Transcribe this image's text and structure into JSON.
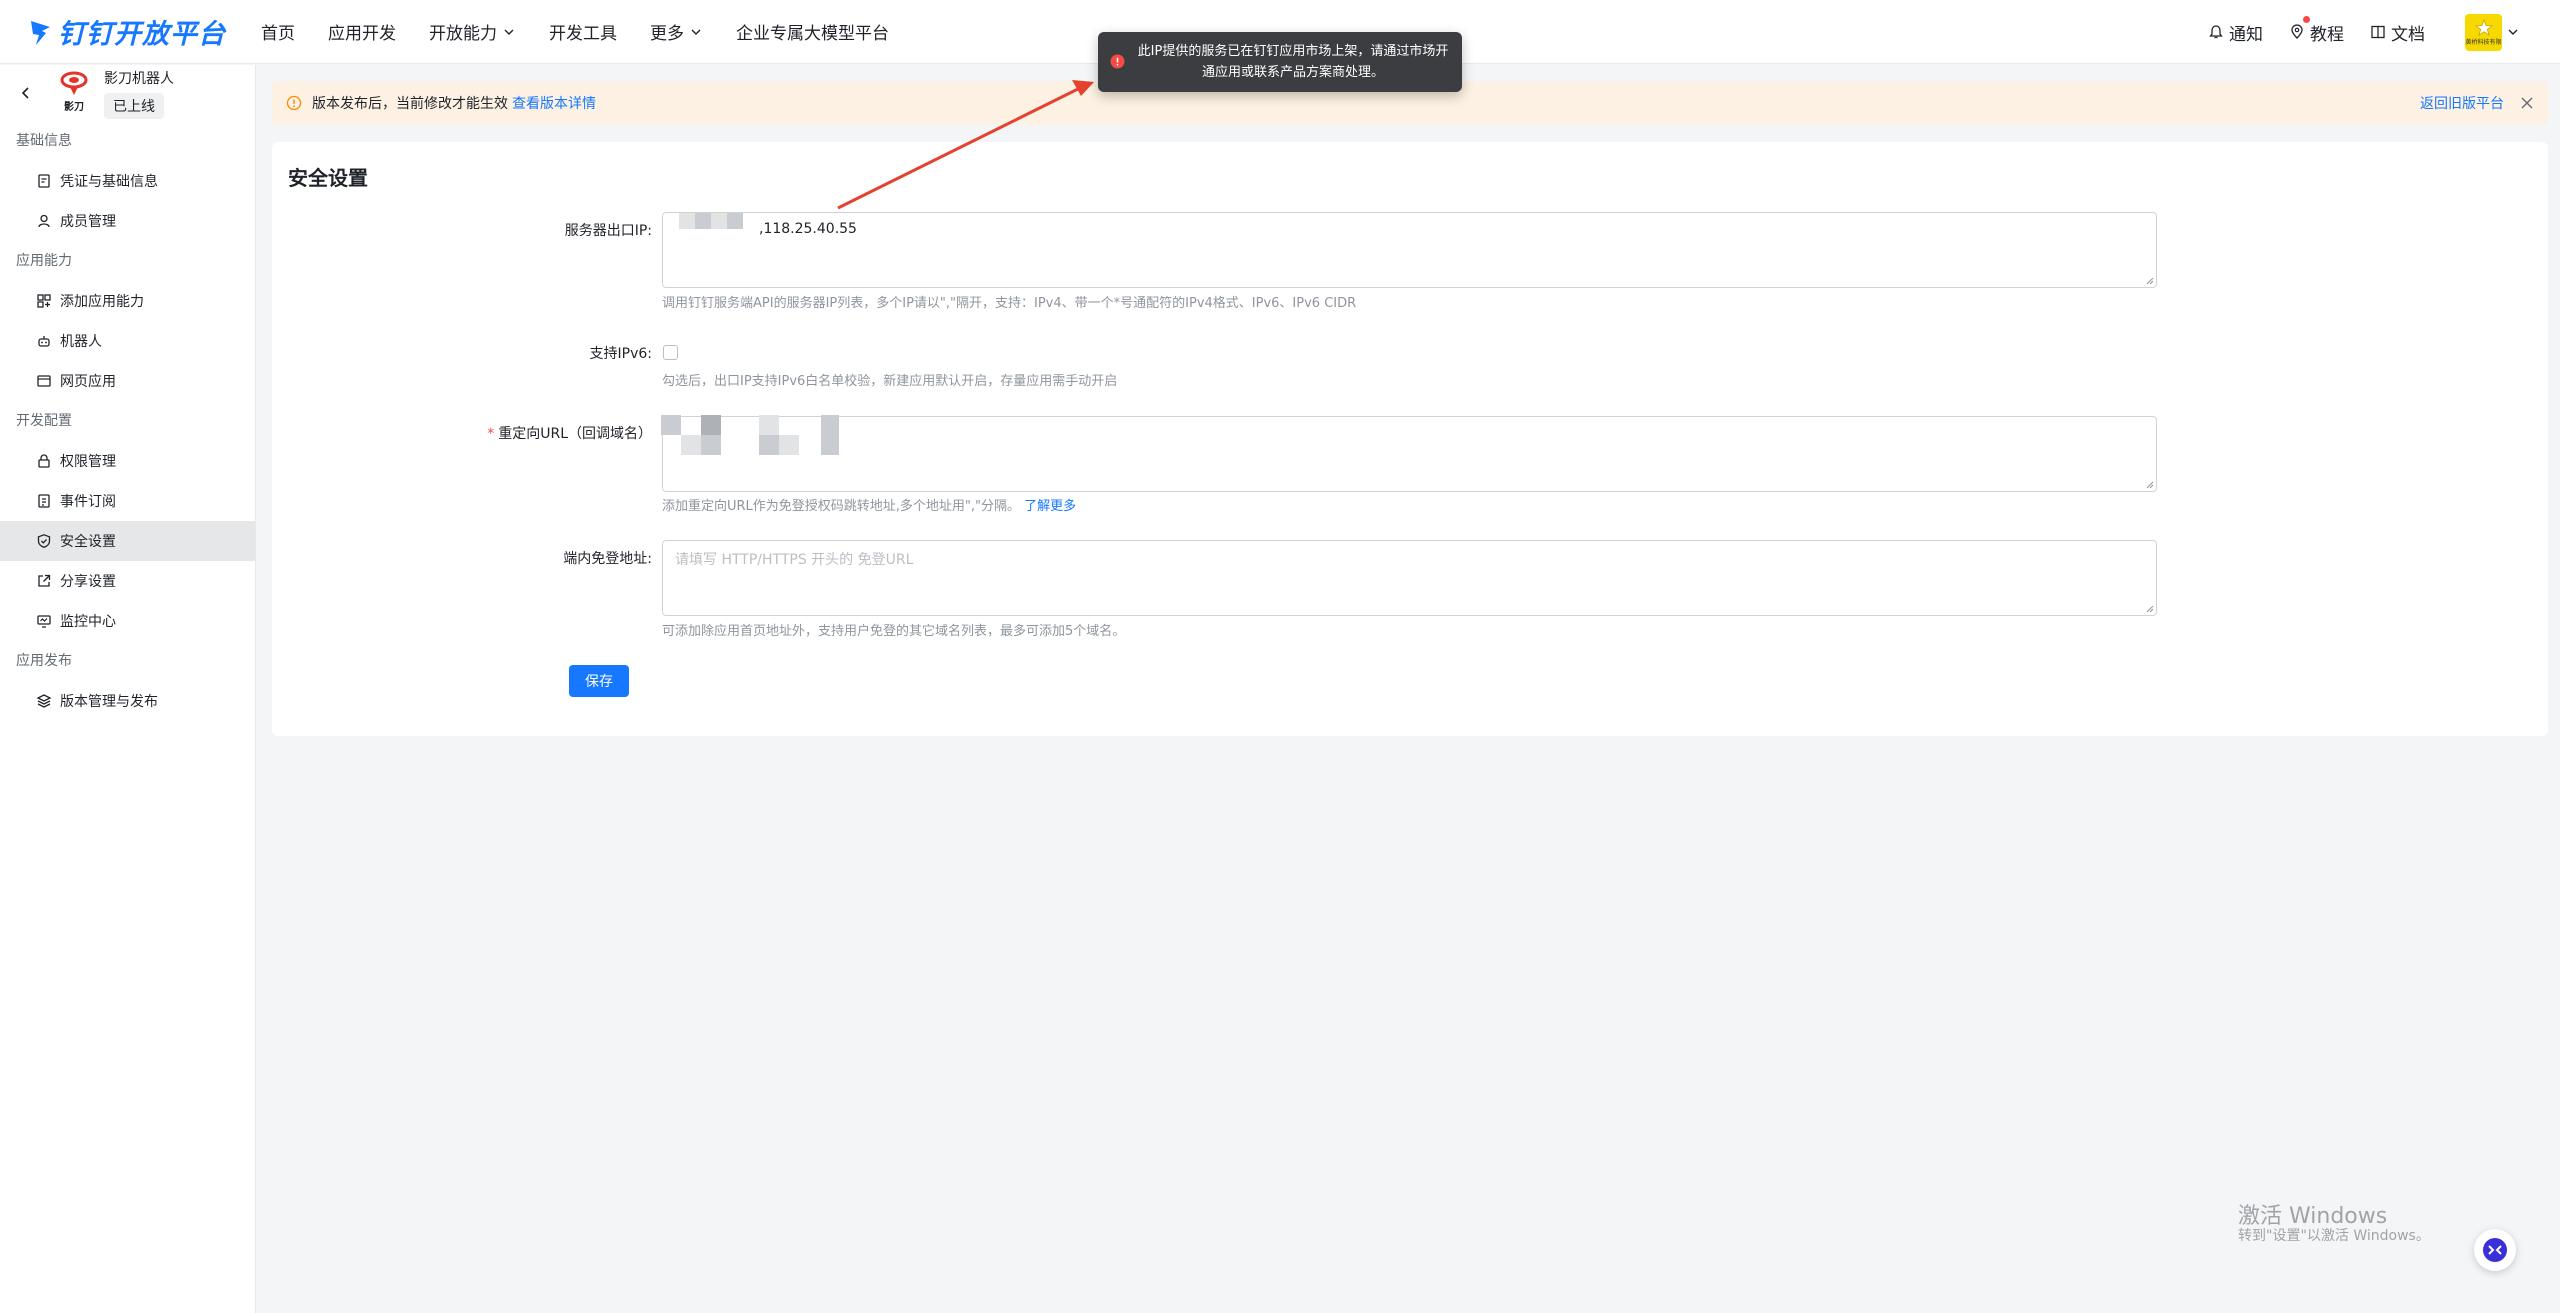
{
  "header": {
    "brand": "钉钉开放平台",
    "nav": [
      {
        "label": "首页",
        "dropdown": false
      },
      {
        "label": "应用开发",
        "dropdown": false
      },
      {
        "label": "开放能力",
        "dropdown": true
      },
      {
        "label": "开发工具",
        "dropdown": false
      },
      {
        "label": "更多",
        "dropdown": true
      },
      {
        "label": "企业专属大模型平台",
        "dropdown": false
      }
    ],
    "notify_label": "通知",
    "tutorial_label": "教程",
    "docs_label": "文档",
    "avatar_text": "黄桥科技有限"
  },
  "sidebar": {
    "app_name": "影刀机器人",
    "app_logo_text": "影刀",
    "status": "已上线",
    "groups": [
      {
        "title": "基础信息",
        "items": [
          {
            "label": "凭证与基础信息",
            "icon": "credential-icon"
          },
          {
            "label": "成员管理",
            "icon": "member-icon"
          }
        ]
      },
      {
        "title": "应用能力",
        "items": [
          {
            "label": "添加应用能力",
            "icon": "add-capability-icon"
          },
          {
            "label": "机器人",
            "icon": "robot-icon"
          },
          {
            "label": "网页应用",
            "icon": "webpage-icon"
          }
        ]
      },
      {
        "title": "开发配置",
        "items": [
          {
            "label": "权限管理",
            "icon": "lock-icon"
          },
          {
            "label": "事件订阅",
            "icon": "event-icon"
          },
          {
            "label": "安全设置",
            "icon": "shield-icon",
            "active": true
          },
          {
            "label": "分享设置",
            "icon": "share-icon"
          },
          {
            "label": "监控中心",
            "icon": "monitor-icon"
          }
        ]
      },
      {
        "title": "应用发布",
        "items": [
          {
            "label": "版本管理与发布",
            "icon": "layers-icon"
          }
        ]
      }
    ]
  },
  "notice": {
    "text": "版本发布后，当前修改才能生效",
    "link": "查看版本详情",
    "back_old": "返回旧版平台"
  },
  "toast": {
    "text": "此IP提供的服务已在钉钉应用市场上架，请通过市场开通应用或联系产品方案商处理。"
  },
  "page": {
    "title": "安全设置",
    "server_ip_label": "服务器出口IP:",
    "server_ip_value": ",118.25.40.55",
    "server_ip_help": "调用钉钉服务端API的服务器IP列表，多个IP请以\",\"隔开，支持：IPv4、带一个*号通配符的IPv4格式、IPv6、IPv6 CIDR",
    "ipv6_label": "支持IPv6:",
    "ipv6_help": "勾选后，出口IP支持IPv6白名单校验，新建应用默认开启，存量应用需手动开启",
    "redirect_label": "重定向URL（回调域名）",
    "redirect_help": "添加重定向URL作为免登授权码跳转地址,多个地址用\",\"分隔。",
    "redirect_help_link": "了解更多",
    "sso_label": "端内免登地址:",
    "sso_placeholder": "请填写 HTTP/HTTPS 开头的 免登URL",
    "sso_help": "可添加除应用首页地址外，支持用户免登的其它域名列表，最多可添加5个域名。",
    "save_label": "保存"
  },
  "watermark": {
    "line1": "激活 Windows",
    "line2": "转到\"设置\"以激活 Windows。"
  }
}
